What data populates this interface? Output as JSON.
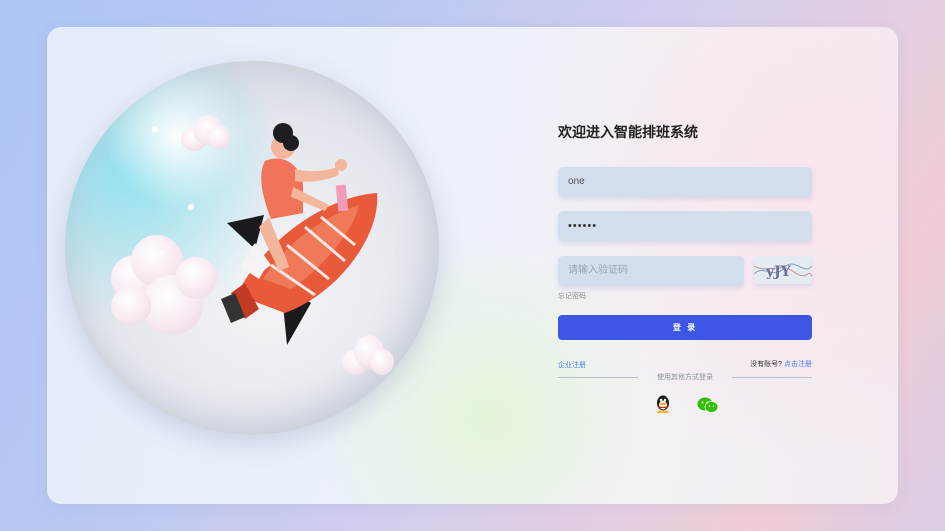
{
  "form": {
    "title": "欢迎进入智能排班系统",
    "username_value": "one",
    "password_value": "••••••",
    "captcha_placeholder": "请输入验证码",
    "captcha_text": "yJY",
    "forgot_password": "忘记密码",
    "login_button": "登 录",
    "enterprise_register": "企业注册",
    "no_account_text": "没有账号?",
    "register_link": "点击注册",
    "other_login_text": "使用其他方式登录",
    "social_icons": [
      "qq-icon",
      "wechat-icon"
    ]
  },
  "colors": {
    "accent": "#3d56e4",
    "link": "#4b7ee8",
    "input_bg": "#d3deec"
  }
}
